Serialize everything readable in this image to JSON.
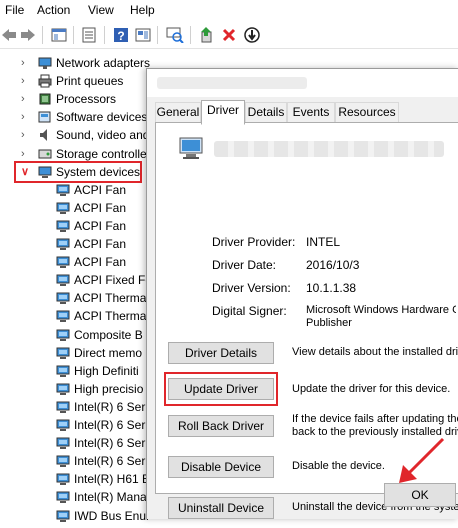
{
  "menu": [
    "File",
    "Action",
    "View",
    "Help"
  ],
  "toolbar": {
    "icons": [
      "back-arrow-icon",
      "forward-arrow-icon",
      "show-hide-tree-icon",
      "properties-icon",
      "help-icon",
      "view-icon",
      "scan-hardware-icon",
      "update-driver-icon",
      "uninstall-icon",
      "disable-icon"
    ]
  },
  "tree": {
    "items": [
      {
        "label": "Network adapters",
        "icon": "network-icon"
      },
      {
        "label": "Print queues",
        "icon": "printer-icon"
      },
      {
        "label": "Processors",
        "icon": "processor-icon"
      },
      {
        "label": "Software devices",
        "icon": "software-device-icon"
      },
      {
        "label": "Sound, video and",
        "icon": "speaker-icon"
      },
      {
        "label": "Storage controlle",
        "icon": "storage-icon"
      },
      {
        "label": "System devices",
        "icon": "system-device-icon"
      },
      {
        "label": "ACPI Fan"
      },
      {
        "label": "ACPI Fan"
      },
      {
        "label": "ACPI Fan"
      },
      {
        "label": "ACPI Fan"
      },
      {
        "label": "ACPI Fan"
      },
      {
        "label": "ACPI Fixed Fe"
      },
      {
        "label": "ACPI Therma"
      },
      {
        "label": "ACPI Therma"
      },
      {
        "label": "Composite B"
      },
      {
        "label": "Direct memo"
      },
      {
        "label": "High Definiti"
      },
      {
        "label": "High precisio"
      },
      {
        "label": "Intel(R) 6 Seri"
      },
      {
        "label": "Intel(R) 6 Seri"
      },
      {
        "label": "Intel(R) 6 Seri"
      },
      {
        "label": "Intel(R) 6 Seri"
      },
      {
        "label": "Intel(R) H61 E"
      },
      {
        "label": "Intel(R) Mana"
      },
      {
        "label": "IWD Bus Enur"
      }
    ]
  },
  "dialog": {
    "tabs": [
      "General",
      "Driver",
      "Details",
      "Events",
      "Resources"
    ],
    "active_tab": "Driver",
    "fields": [
      {
        "label": "Driver Provider:",
        "value": "INTEL"
      },
      {
        "label": "Driver Date:",
        "value": "2016/10/3"
      },
      {
        "label": "Driver Version:",
        "value": "10.1.1.38"
      },
      {
        "label": "Digital Signer:",
        "value": "Microsoft Windows Hardware Co",
        "value2": "Publisher"
      }
    ],
    "buttons": [
      {
        "label": "Driver Details",
        "desc": "View details about the installed driv"
      },
      {
        "label": "Update Driver",
        "desc": "Update the driver for this device."
      },
      {
        "label": "Roll Back Driver",
        "desc": "If the device fails after updating the",
        "desc2": "back to the previously installed driver"
      },
      {
        "label": "Disable Device",
        "desc": "Disable the device."
      },
      {
        "label": "Uninstall Device",
        "desc": "Uninstall the device from the system"
      }
    ],
    "ok_label": "OK"
  },
  "colors": {
    "highlight_red": "#e0262b",
    "accent_blue": "#1e6fd9"
  }
}
